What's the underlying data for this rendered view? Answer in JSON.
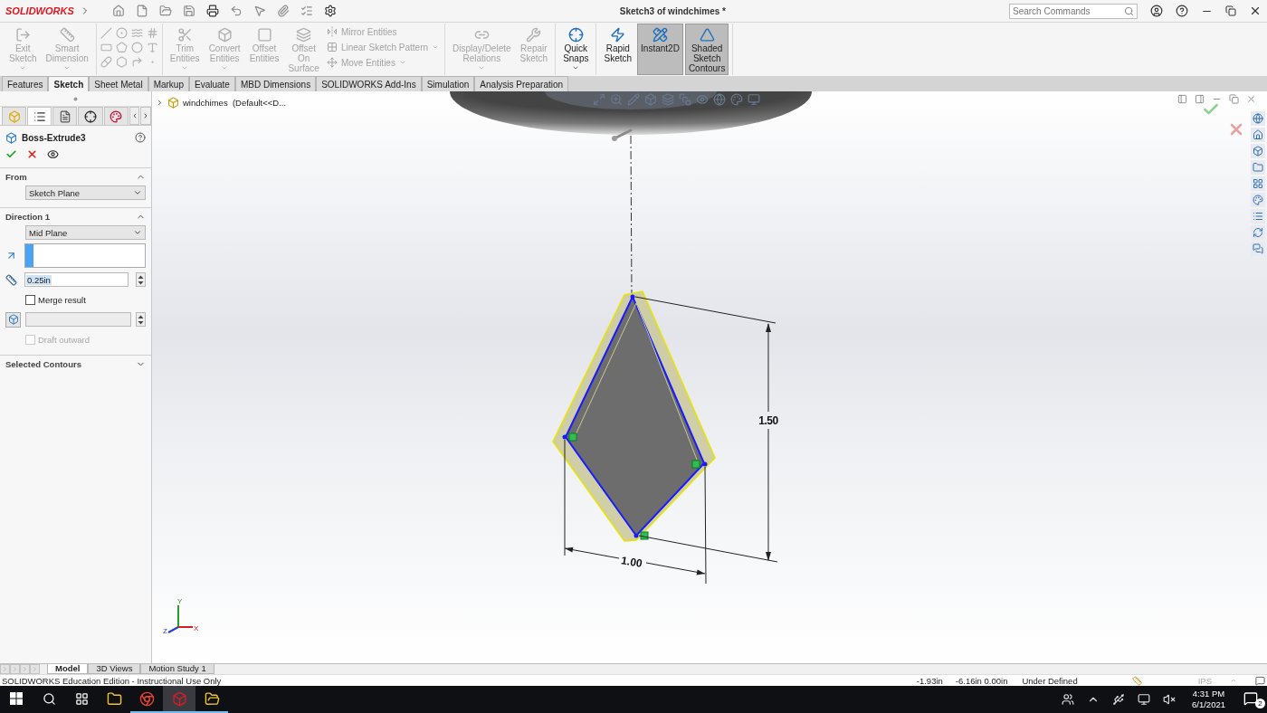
{
  "title_bar": {
    "logo": "SOLIDWORKS",
    "title": "Sketch3 of windchimes *",
    "search": {
      "placeholder": "Search Commands"
    }
  },
  "ribbon": {
    "groups": [
      {
        "commands": [
          {
            "kind": "large",
            "label": "Exit Sketch",
            "disabled": true,
            "selected": false,
            "menu": true
          },
          {
            "kind": "large",
            "label": "Smart Dimension",
            "disabled": true,
            "selected": false,
            "menu": true
          }
        ]
      },
      {
        "commands": [
          {
            "kind": "tools",
            "disabled": true
          }
        ]
      },
      {
        "commands": [
          {
            "kind": "large",
            "label": "Trim Entities",
            "disabled": true,
            "selected": false,
            "menu": true
          },
          {
            "kind": "large",
            "label": "Convert Entities",
            "disabled": true,
            "selected": false,
            "menu": true
          },
          {
            "kind": "large",
            "label": "Offset Entities",
            "disabled": true,
            "selected": false,
            "menu": false
          },
          {
            "kind": "large",
            "label": "Offset On Surface",
            "disabled": true,
            "selected": false,
            "menu": false
          },
          {
            "kind": "small",
            "label": "Mirror Entities",
            "disabled": true,
            "menu": false
          },
          {
            "kind": "small",
            "label": "Linear Sketch Pattern",
            "disabled": true,
            "menu": true
          },
          {
            "kind": "small",
            "label": "Move Entities",
            "disabled": true,
            "menu": true
          }
        ]
      },
      {
        "commands": [
          {
            "kind": "large",
            "label": "Display/Delete Relations",
            "disabled": true,
            "selected": false,
            "menu": true
          },
          {
            "kind": "large",
            "label": "Repair Sketch",
            "disabled": true,
            "selected": false,
            "menu": false
          }
        ]
      },
      {
        "commands": [
          {
            "kind": "large",
            "label": "Quick Snaps",
            "disabled": false,
            "selected": false,
            "menu": true
          }
        ]
      },
      {
        "commands": [
          {
            "kind": "large",
            "label": "Rapid Sketch",
            "disabled": false,
            "selected": false,
            "menu": false
          },
          {
            "kind": "large",
            "label": "Instant2D",
            "disabled": false,
            "selected": true,
            "menu": false
          },
          {
            "kind": "large",
            "label": "Shaded Sketch Contours",
            "disabled": false,
            "selected": true,
            "menu": false
          }
        ]
      }
    ]
  },
  "command_tabs": [
    {
      "label": "Features",
      "selected": false
    },
    {
      "label": "Sketch",
      "selected": true
    },
    {
      "label": "Sheet Metal",
      "selected": false
    },
    {
      "label": "Markup",
      "selected": false
    },
    {
      "label": "Evaluate",
      "selected": false
    },
    {
      "label": "MBD Dimensions",
      "selected": false
    },
    {
      "label": "SOLIDWORKS Add-Ins",
      "selected": false
    },
    {
      "label": "Simulation",
      "selected": false
    },
    {
      "label": "Analysis Preparation",
      "selected": false
    }
  ],
  "panel_tabs": [
    {
      "selected": false
    },
    {
      "selected": true
    },
    {
      "selected": false
    },
    {
      "selected": false
    },
    {
      "selected": false
    }
  ],
  "property_manager": {
    "title": "Boss-Extrude3",
    "from": {
      "title": "From",
      "expanded": true,
      "start_condition": "Sketch Plane"
    },
    "direction1": {
      "title": "Direction 1",
      "expanded": true,
      "end_condition": "Mid Plane",
      "depth": "0.25in",
      "depth_text_selected": true,
      "merge_result": {
        "label": "Merge result",
        "checked": false,
        "disabled": false
      },
      "draft_outward": {
        "label": "Draft outward",
        "checked": false,
        "disabled": true
      }
    },
    "selected_contours": {
      "title": "Selected Contours",
      "expanded": false
    }
  },
  "feature_tree": {
    "item": "windchimes  (Default<<D...",
    "expanded": false
  },
  "viewport": {
    "dimension_vertical": "1.50",
    "dimension_horizontal": "1.00",
    "triad": {
      "y": "Y",
      "x": "X",
      "z": "Z"
    }
  },
  "bottom_tabs": [
    {
      "label": "Model",
      "selected": true
    },
    {
      "label": "3D Views",
      "selected": false
    },
    {
      "label": "Motion Study 1",
      "selected": false
    }
  ],
  "status_bar": {
    "message": "SOLIDWORKS Education Edition - Instructional Use Only",
    "x": "-1.93in",
    "yz": "-6.16in 0.00in",
    "state": "Under Defined",
    "units": "IPS"
  },
  "taskbar": {
    "apps": [
      {
        "running": false,
        "selected": false
      },
      {
        "running": true,
        "selected": false
      },
      {
        "running": true,
        "selected": true
      },
      {
        "running": true,
        "selected": false
      }
    ],
    "time": "4:31 PM",
    "date": "6/1/2021",
    "notifications": "2"
  }
}
